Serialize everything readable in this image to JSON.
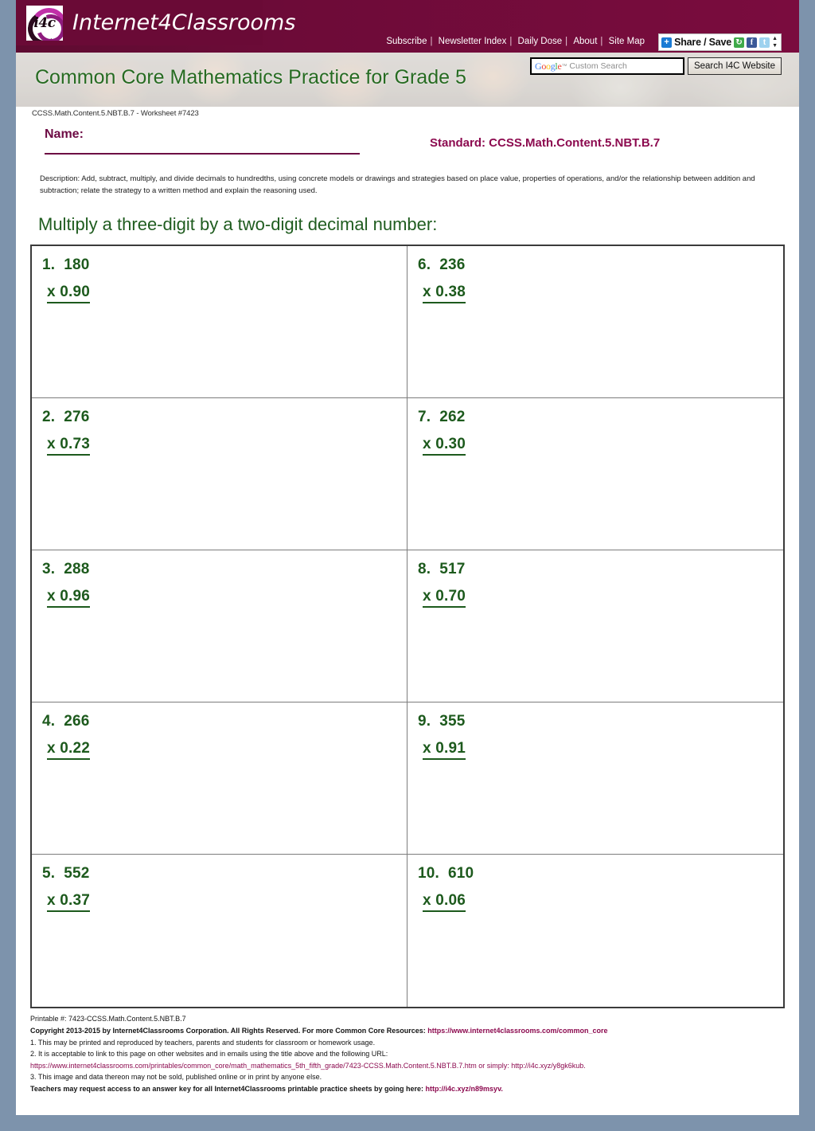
{
  "site": {
    "brand_name": "Internet4Classrooms",
    "logo_text": "i4c"
  },
  "topnav": {
    "items": [
      {
        "label": "Subscribe"
      },
      {
        "label": "Newsletter Index"
      },
      {
        "label": "Daily Dose"
      },
      {
        "label": "About"
      },
      {
        "label": "Site Map"
      }
    ],
    "separator": "|"
  },
  "share_widget": {
    "label": "Share / Save",
    "plus_icon": "+",
    "icons": [
      "recycle-icon",
      "facebook-icon",
      "twitter-icon"
    ],
    "facebook_glyph": "f",
    "twitter_glyph": "t",
    "recycle_glyph": "↻",
    "up_arrow": "▲",
    "down_arrow": "▼"
  },
  "search": {
    "placeholder": "Custom Search",
    "google_word": "Google",
    "tm": "™",
    "button_label": "Search I4C Website"
  },
  "banner": {
    "title": "Common Core Mathematics Practice for Grade 5"
  },
  "worksheet": {
    "sheet_id": "CCSS.Math.Content.5.NBT.B.7 - Worksheet #7423",
    "name_label": "Name:",
    "standard": "Standard: CCSS.Math.Content.5.NBT.B.7",
    "description": "Description: Add, subtract, multiply, and divide decimals to hundredths, using concrete models or drawings and strategies based on place value, properties of operations, and/or the relationship between addition and subtraction; relate the strategy to a written method and explain the reasoning used.",
    "instruction": "Multiply a three-digit by a two-digit decimal number:",
    "problems": [
      {
        "num": "1.",
        "top": "180",
        "bottom": "x 0.90"
      },
      {
        "num": "6.",
        "top": "236",
        "bottom": "x 0.38"
      },
      {
        "num": "2.",
        "top": "276",
        "bottom": "x 0.73"
      },
      {
        "num": "7.",
        "top": "262",
        "bottom": "x 0.30"
      },
      {
        "num": "3.",
        "top": "288",
        "bottom": "x 0.96"
      },
      {
        "num": "8.",
        "top": "517",
        "bottom": "x 0.70"
      },
      {
        "num": "4.",
        "top": "266",
        "bottom": "x 0.22"
      },
      {
        "num": "9.",
        "top": "355",
        "bottom": "x 0.91"
      },
      {
        "num": "5.",
        "top": "552",
        "bottom": "x 0.37"
      },
      {
        "num": "10.",
        "top": "610",
        "bottom": "x 0.06"
      }
    ]
  },
  "footer": {
    "printable": "Printable #: 7423-CCSS.Math.Content.5.NBT.B.7",
    "copyright_text": "Copyright 2013-2015 by Internet4Classrooms Corporation. All Rights Reserved. For more Common Core Resources: ",
    "copyright_link": "https://www.internet4classrooms.com/common_core",
    "note1": "1. This may be printed and reproduced by teachers, parents and students for classroom or homework usage.",
    "note2": "2. It is acceptable to link to this page on other websites and in emails using the title above and the following URL:",
    "url_line": "https://www.internet4classrooms.com/printables/common_core/math_mathematics_5th_fifth_grade/7423-CCSS.Math.Content.5.NBT.B.7.htm or simply: http://i4c.xyz/y8gk6kub.",
    "note3": "3. This image and data thereon may not be sold, published online or in print by anyone else.",
    "answer_key_text": "Teachers may request access to an answer key for all Internet4Classrooms printable practice sheets by going here: ",
    "answer_key_link": "http://i4c.xyz/n89msyv."
  },
  "colors": {
    "brand_maroon": "#6d0b38",
    "standard_magenta": "#8c0a4f",
    "problem_green": "#1d5a1d",
    "title_green": "#276b22",
    "page_backdrop": "#7d93ac"
  }
}
